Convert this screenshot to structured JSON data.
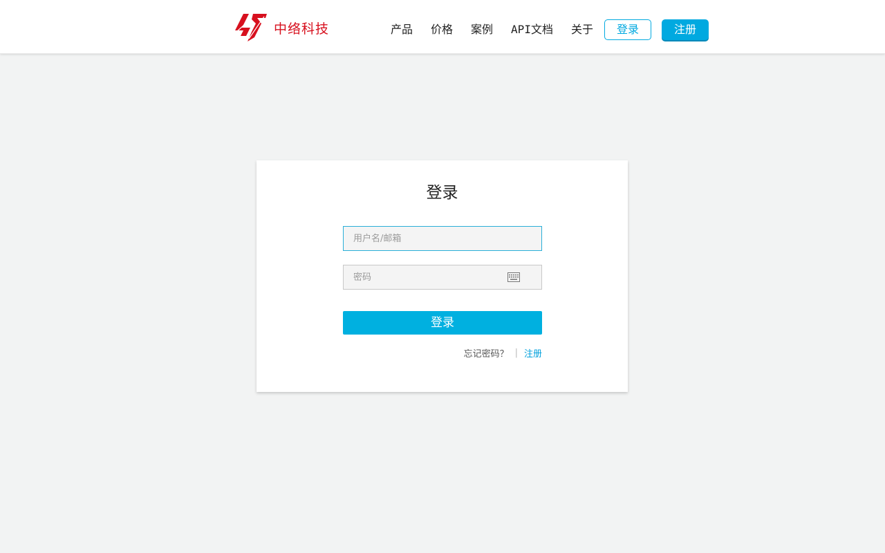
{
  "header": {
    "brand": "中络科技",
    "brand_color": "#d7101e",
    "nav": [
      "产品",
      "价格",
      "案例",
      "API文档",
      "关于"
    ],
    "login_label": "登录",
    "register_label": "注册",
    "accent_color": "#00a9e0"
  },
  "login_card": {
    "title": "登录",
    "username_placeholder": "用户名/邮箱",
    "password_placeholder": "密码",
    "keyboard_icon": "keyboard-icon",
    "submit_label": "登录",
    "forgot_label": "忘记密码？",
    "separator": "|",
    "register_link": "注册"
  }
}
